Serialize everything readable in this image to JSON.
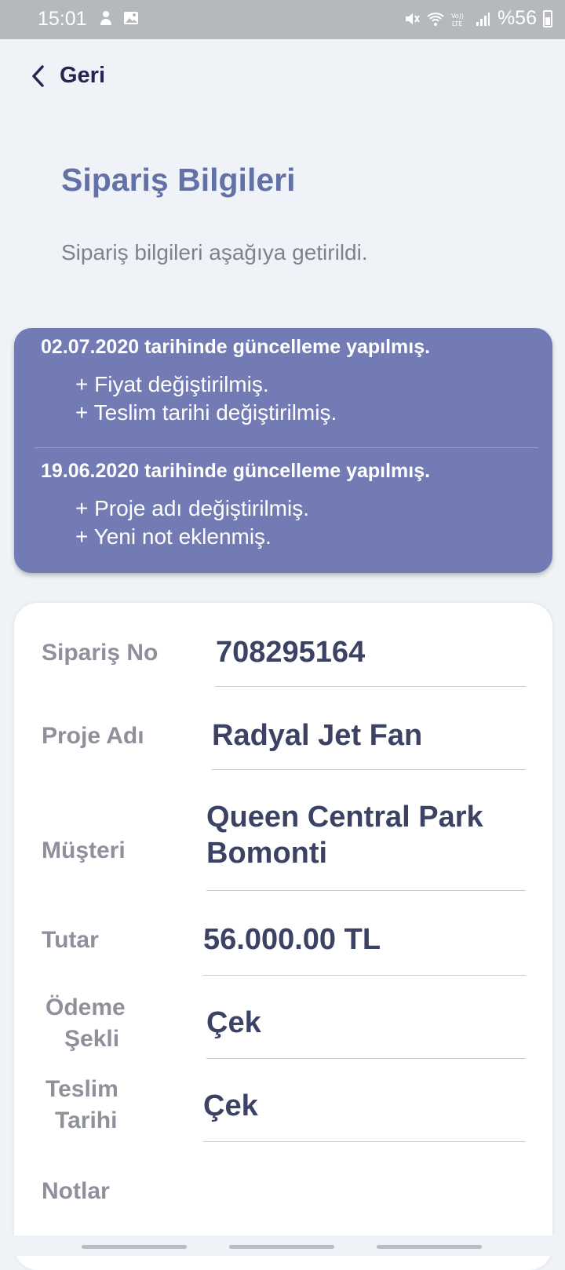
{
  "status_bar": {
    "time": "15:01",
    "battery": "%56",
    "icons": [
      "person-icon",
      "image-icon",
      "mute-icon",
      "wifi-icon",
      "volte-icon",
      "signal-icon",
      "battery-icon"
    ]
  },
  "back": {
    "label": "Geri"
  },
  "header": {
    "title": "Sipariş Bilgileri",
    "subtitle": "Sipariş bilgileri aşağıya getirildi."
  },
  "updates": [
    {
      "heading": "02.07.2020 tarihinde güncelleme yapılmış.",
      "changes": [
        "+ Fiyat değiştirilmiş.",
        "+ Teslim tarihi değiştirilmiş."
      ]
    },
    {
      "heading": "19.06.2020 tarihinde güncelleme yapılmış.",
      "changes": [
        "+ Proje adı değiştirilmiş.",
        "+ Yeni not eklenmiş."
      ]
    }
  ],
  "order": {
    "fields": [
      {
        "label": "Sipariş No",
        "value": "708295164"
      },
      {
        "label": "Proje Adı",
        "value": "Radyal Jet Fan"
      },
      {
        "label": "Müşteri",
        "value": [
          "Queen Central Park",
          "Bomonti"
        ]
      },
      {
        "label": "Tutar",
        "value": "56.000.00 TL"
      },
      {
        "label": [
          "Ödeme",
          "Şekli"
        ],
        "value": "Çek"
      },
      {
        "label": [
          "Teslim",
          "Tarihi"
        ],
        "value": "Çek"
      },
      {
        "label": "Notlar",
        "value": ""
      }
    ]
  },
  "colors": {
    "accent": "#6471a7",
    "update_card": "#737bb4",
    "value_text": "#3b4264",
    "label_text": "#8e909b",
    "background": "#eff3f7"
  }
}
